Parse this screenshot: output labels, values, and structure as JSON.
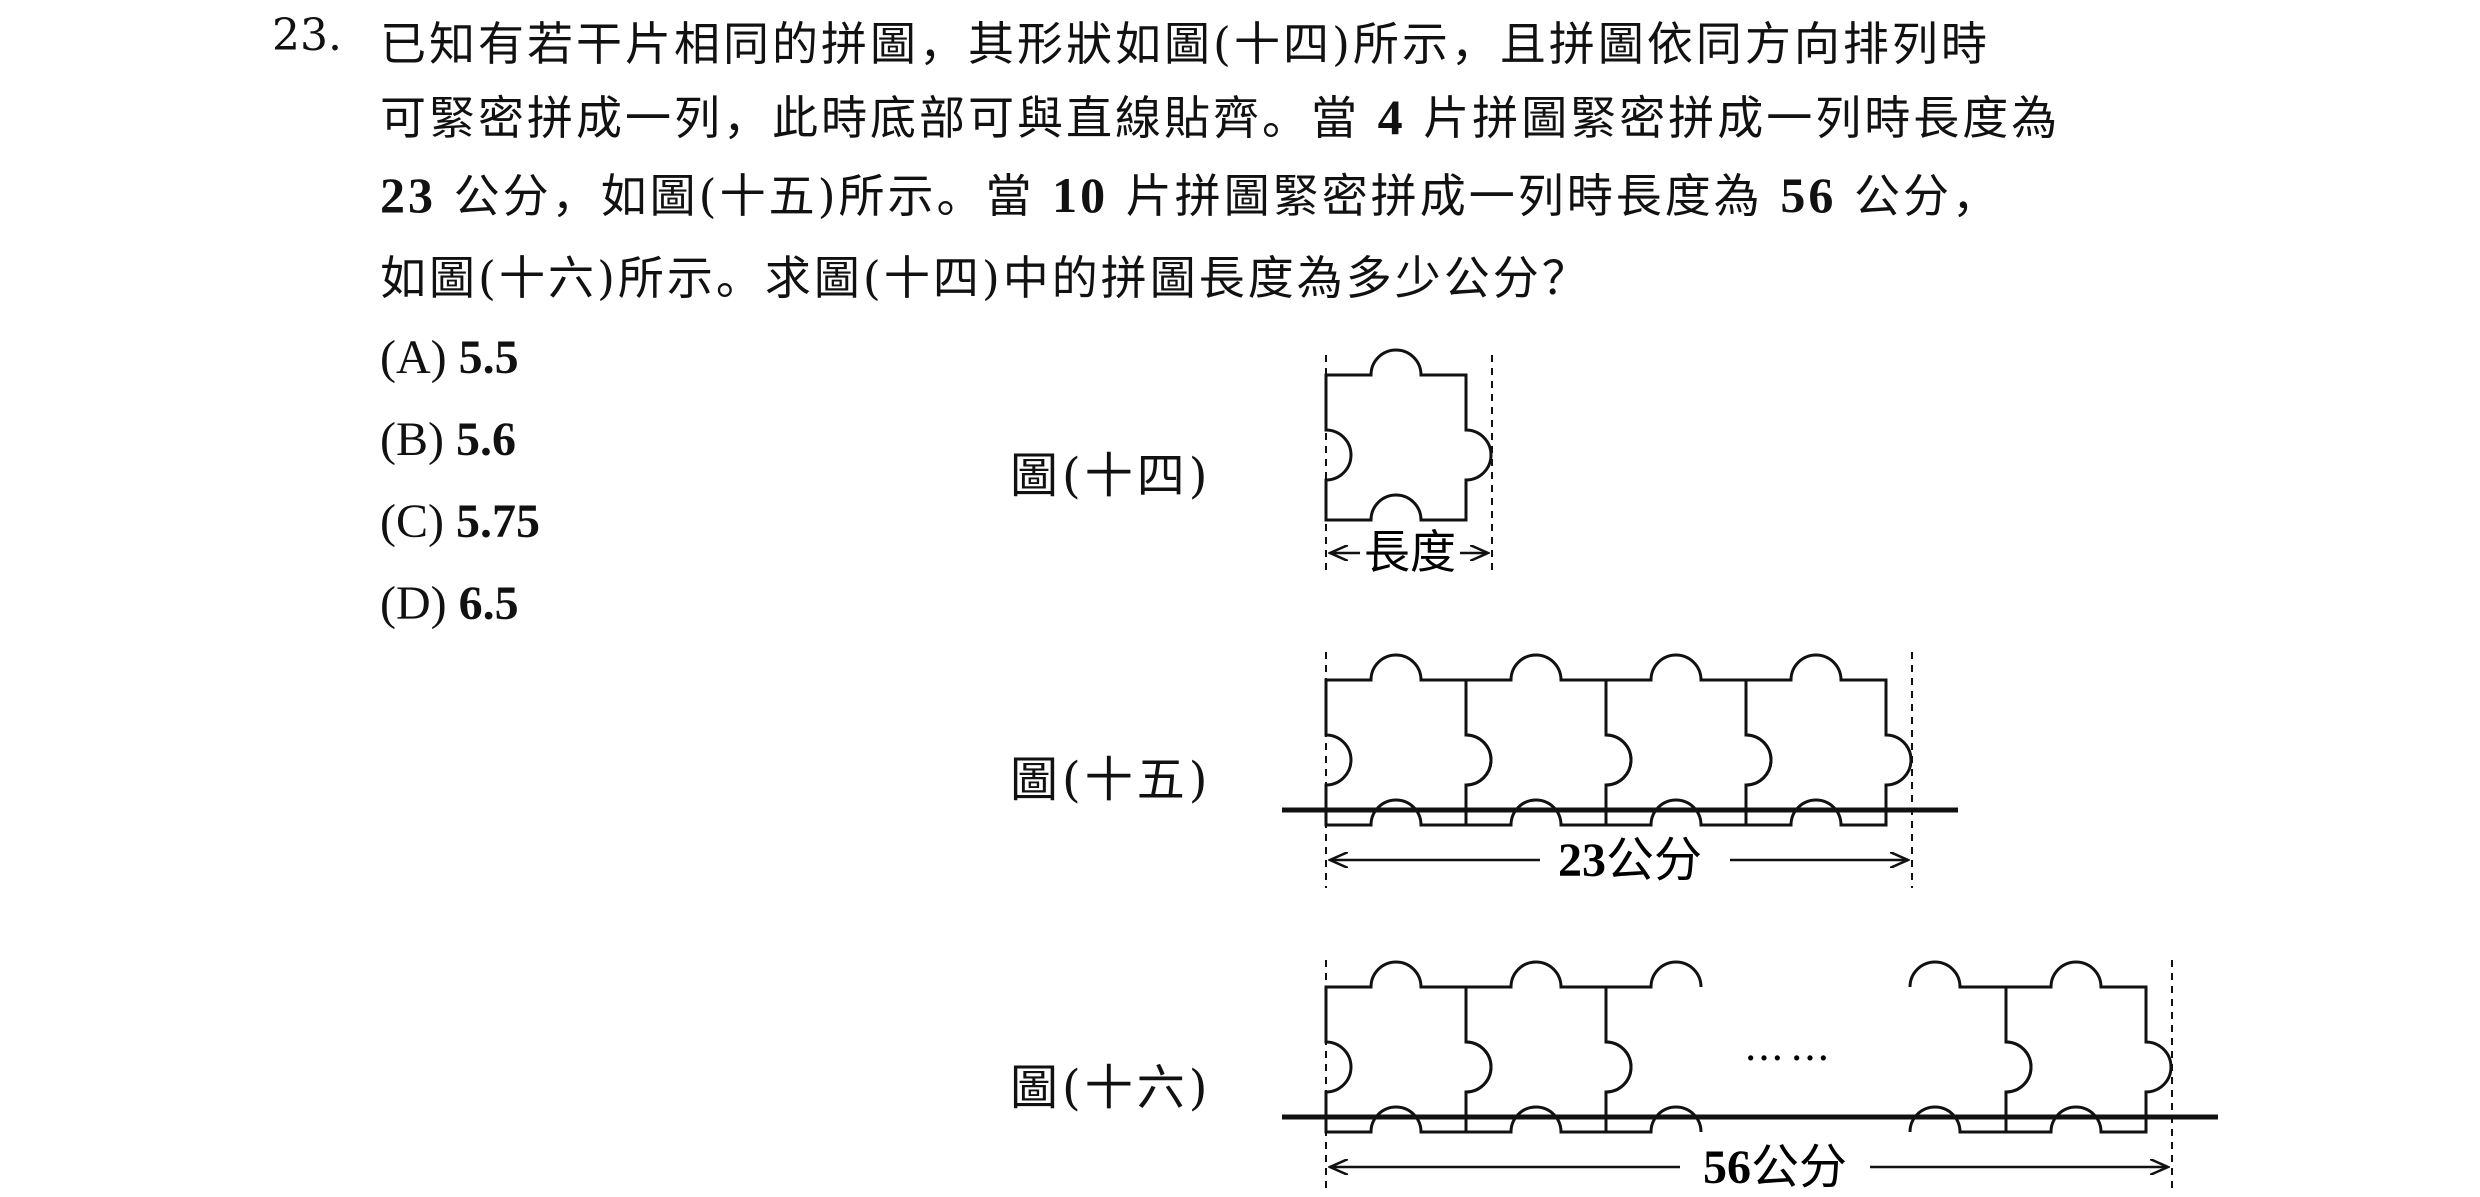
{
  "question": {
    "number": "23.",
    "lines": [
      "已知有若干片相同的拼圖，其形狀如圖(十四)所示，且拼圖依同方向排列時",
      "可緊密拼成一列，此時底部可與直線貼齊。當",
      "片拼圖緊密拼成一列時長度為",
      "公分，如圖(十五)所示。當",
      "片拼圖緊密拼成一列時長度為",
      "公分，",
      "如圖(十六)所示。求圖(十四)中的拼圖長度為多少公分？"
    ],
    "n_small": "4",
    "len_small": "23",
    "n_large": "10",
    "len_large": "56"
  },
  "options": [
    {
      "label": "(A)",
      "value": "5.5"
    },
    {
      "label": "(B)",
      "value": "5.6"
    },
    {
      "label": "(C)",
      "value": "5.75"
    },
    {
      "label": "(D)",
      "value": "6.5"
    }
  ],
  "figures": {
    "fig14_label": "圖(十四)",
    "fig15_label": "圖(十五)",
    "fig16_label": "圖(十六)",
    "length_label": "長度",
    "fig15_measure_num": "23",
    "fig15_measure_unit": "公分",
    "fig16_measure_num": "56",
    "fig16_measure_unit": "公分",
    "ellipsis": "……"
  }
}
